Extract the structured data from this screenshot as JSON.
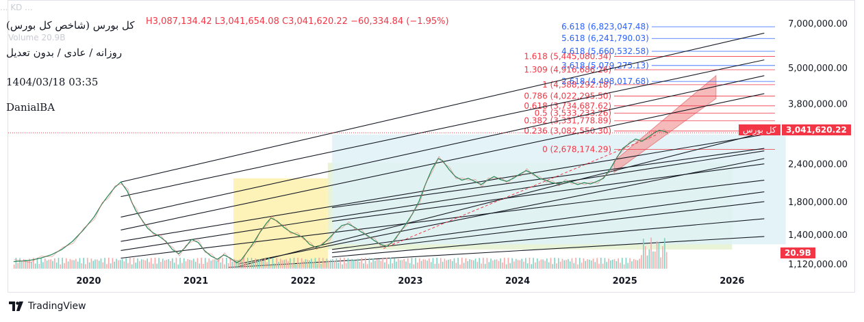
{
  "header": {
    "title": "کل بورس (شاخص کل بورس)",
    "subtitle": "روزانه / عادی / بدون تعدیل",
    "datetime": "1404/03/18 03:35",
    "author": "DanialBA",
    "ohlc": {
      "h": "H3,087,134.42",
      "l": "L3,041,654.08",
      "c": "C3,041,620.22",
      "change": "−60,334.84 (−1.95%)"
    },
    "ghost_text": "... KD ... ",
    "volume_label": "Volume",
    "volume_value": "20.9B"
  },
  "branding": {
    "name": "TradingView"
  },
  "price_tag": {
    "label": "کل بورس",
    "value": "3,041,620.22",
    "color": "#f23645"
  },
  "volume_tag": {
    "value": "20.9B",
    "color": "#f23645"
  },
  "chart_data": {
    "type": "line",
    "title": "کل بورس (شاخص کل بورس)",
    "y_scale": "log",
    "y_ticks": [
      {
        "v": 7000000,
        "label": "7,000,000.00"
      },
      {
        "v": 5000000,
        "label": "5,000,000.00"
      },
      {
        "v": 3800000,
        "label": "3,800,000.00"
      },
      {
        "v": 2400000,
        "label": "2,400,000.00"
      },
      {
        "v": 1800000,
        "label": "1,800,000.00"
      },
      {
        "v": 1400000,
        "label": "1,400,000.00"
      },
      {
        "v": 1120000,
        "label": "1,120,000.00"
      }
    ],
    "x_ticks": [
      "2020",
      "2021",
      "2022",
      "2023",
      "2024",
      "2025",
      "2026"
    ],
    "x_range": [
      2019.25,
      2026.4
    ],
    "y_range": [
      1080000,
      7900000
    ],
    "series": [
      {
        "color": "#089981",
        "points": [
          [
            2019.3,
            1140000
          ],
          [
            2019.45,
            1150000
          ],
          [
            2019.55,
            1170000
          ],
          [
            2019.65,
            1200000
          ],
          [
            2019.75,
            1250000
          ],
          [
            2019.85,
            1330000
          ],
          [
            2019.95,
            1450000
          ],
          [
            2020.05,
            1600000
          ],
          [
            2020.12,
            1760000
          ],
          [
            2020.18,
            1880000
          ],
          [
            2020.24,
            2000000
          ],
          [
            2020.3,
            2090000
          ],
          [
            2020.36,
            1950000
          ],
          [
            2020.4,
            1800000
          ],
          [
            2020.44,
            1680000
          ],
          [
            2020.5,
            1560000
          ],
          [
            2020.55,
            1470000
          ],
          [
            2020.6,
            1420000
          ],
          [
            2020.66,
            1380000
          ],
          [
            2020.72,
            1330000
          ],
          [
            2020.78,
            1250000
          ],
          [
            2020.84,
            1210000
          ],
          [
            2020.9,
            1270000
          ],
          [
            2020.96,
            1350000
          ],
          [
            2021.02,
            1320000
          ],
          [
            2021.08,
            1240000
          ],
          [
            2021.14,
            1190000
          ],
          [
            2021.2,
            1160000
          ],
          [
            2021.26,
            1200000
          ],
          [
            2021.32,
            1170000
          ],
          [
            2021.38,
            1130000
          ],
          [
            2021.42,
            1150000
          ],
          [
            2021.48,
            1230000
          ],
          [
            2021.54,
            1320000
          ],
          [
            2021.6,
            1430000
          ],
          [
            2021.66,
            1530000
          ],
          [
            2021.7,
            1590000
          ],
          [
            2021.76,
            1550000
          ],
          [
            2021.82,
            1480000
          ],
          [
            2021.88,
            1430000
          ],
          [
            2021.94,
            1400000
          ],
          [
            2022.0,
            1370000
          ],
          [
            2022.06,
            1300000
          ],
          [
            2022.12,
            1270000
          ],
          [
            2022.18,
            1300000
          ],
          [
            2022.24,
            1360000
          ],
          [
            2022.3,
            1430000
          ],
          [
            2022.36,
            1500000
          ],
          [
            2022.42,
            1520000
          ],
          [
            2022.48,
            1480000
          ],
          [
            2022.54,
            1430000
          ],
          [
            2022.6,
            1390000
          ],
          [
            2022.66,
            1340000
          ],
          [
            2022.72,
            1300000
          ],
          [
            2022.78,
            1280000
          ],
          [
            2022.84,
            1330000
          ],
          [
            2022.9,
            1420000
          ],
          [
            2022.96,
            1520000
          ],
          [
            2023.02,
            1640000
          ],
          [
            2023.08,
            1800000
          ],
          [
            2023.14,
            2050000
          ],
          [
            2023.2,
            2300000
          ],
          [
            2023.26,
            2500000
          ],
          [
            2023.3,
            2460000
          ],
          [
            2023.36,
            2300000
          ],
          [
            2023.42,
            2180000
          ],
          [
            2023.48,
            2120000
          ],
          [
            2023.54,
            2150000
          ],
          [
            2023.6,
            2100000
          ],
          [
            2023.66,
            2050000
          ],
          [
            2023.72,
            2120000
          ],
          [
            2023.78,
            2180000
          ],
          [
            2023.84,
            2130000
          ],
          [
            2023.9,
            2100000
          ],
          [
            2023.96,
            2150000
          ],
          [
            2024.02,
            2220000
          ],
          [
            2024.08,
            2280000
          ],
          [
            2024.14,
            2230000
          ],
          [
            2024.2,
            2150000
          ],
          [
            2024.26,
            2120000
          ],
          [
            2024.32,
            2080000
          ],
          [
            2024.38,
            2060000
          ],
          [
            2024.44,
            2100000
          ],
          [
            2024.5,
            2090000
          ],
          [
            2024.56,
            2050000
          ],
          [
            2024.62,
            2080000
          ],
          [
            2024.68,
            2060000
          ],
          [
            2024.74,
            2100000
          ],
          [
            2024.8,
            2150000
          ],
          [
            2024.86,
            2300000
          ],
          [
            2024.92,
            2500000
          ],
          [
            2024.98,
            2700000
          ],
          [
            2025.04,
            2800000
          ],
          [
            2025.1,
            2900000
          ],
          [
            2025.16,
            2850000
          ],
          [
            2025.22,
            2950000
          ],
          [
            2025.28,
            3050000
          ],
          [
            2025.32,
            3100000
          ],
          [
            2025.36,
            3080000
          ],
          [
            2025.4,
            3041620
          ]
        ]
      }
    ],
    "fib_levels": [
      {
        "label": "1.618 (5,445,080.34)",
        "value": 5445080.34,
        "color": "#f23645"
      },
      {
        "label": "1.309 (4,916,686.26)",
        "value": 4916686.26,
        "color": "#f23645"
      },
      {
        "label": "1 (4,388,292.18)",
        "value": 4388292.18,
        "color": "#f23645"
      },
      {
        "label": "0.786 (4,022,295.50)",
        "value": 4022295.5,
        "color": "#f23645"
      },
      {
        "label": "0.618 (3,734,687.62)",
        "value": 3734687.62,
        "color": "#f23645"
      },
      {
        "label": "0.5 (3,533,233.26)",
        "value": 3533233.26,
        "color": "#f23645"
      },
      {
        "label": "0.382 (3,331,778.89)",
        "value": 3331778.89,
        "color": "#f23645"
      },
      {
        "label": "0.236 (3,082,550.30)",
        "value": 3082550.3,
        "color": "#f23645"
      },
      {
        "label": "0 (2,678,174.29)",
        "value": 2678174.29,
        "color": "#f23645"
      }
    ],
    "fib_ext_levels": [
      {
        "label": "6.618 (6,823,047.48)",
        "value": 6823047.48,
        "color": "#2962ff"
      },
      {
        "label": "5.618 (6,241,790.03)",
        "value": 6241790.03,
        "color": "#2962ff"
      },
      {
        "label": "4.618 (5,660,532.58)",
        "value": 5660532.58,
        "color": "#2962ff"
      },
      {
        "label": "3.618 (5,079,275.13)",
        "value": 5079275.13,
        "color": "#2962ff"
      },
      {
        "label": "2.618 (4,498,017.68)",
        "value": 4498017.68,
        "color": "#2962ff"
      }
    ],
    "volume_bars": {
      "color_up": "#7fd1c4",
      "color_down": "#f7a9a8",
      "highlight": "20.9B"
    },
    "shaded_zones": [
      {
        "name": "yellow-zone",
        "x0": 2021.35,
        "x1": 2022.23,
        "color": "#fdf1b0"
      },
      {
        "name": "green-zone",
        "x0": 2022.23,
        "x1": 2026.0,
        "color": "#e7f2d3"
      },
      {
        "name": "blue-zone",
        "x0": 2022.27,
        "x1": 2026.5,
        "color": "#dff1f7"
      },
      {
        "name": "red-channel",
        "x0": 2024.9,
        "x1": 2025.85,
        "color": "#f3a2a2"
      }
    ]
  }
}
